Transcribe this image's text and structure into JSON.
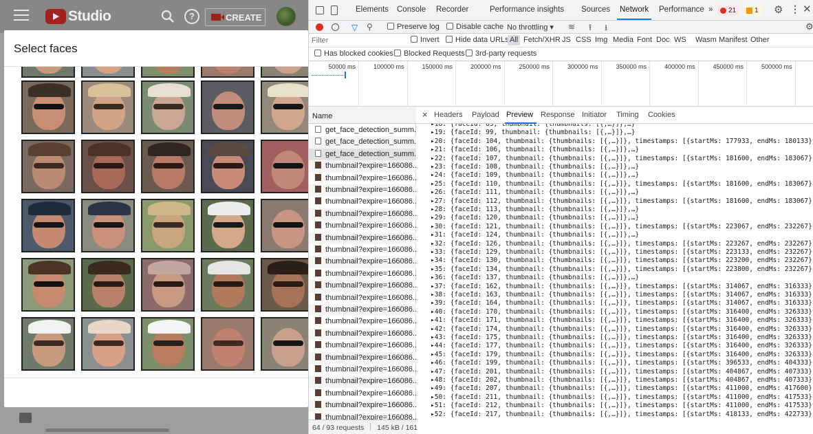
{
  "youtube": {
    "logo_text": "Studio",
    "create_label": "CREATE",
    "help_glyph": "?",
    "modal_title": "Select faces",
    "faces": [
      {
        "skin": "#c79a7e",
        "hat": "#f2f2f2",
        "eyes": "#3a2a22",
        "bg": "#6f7a6a"
      },
      {
        "skin": "#d9a088",
        "hat": "#e8d8c8",
        "eyes": "#3a2a22",
        "bg": "#8a8f90"
      },
      {
        "skin": "#b87c5e",
        "hat": "#f4f4f4",
        "eyes": "#2a2020",
        "bg": "#7b8f6a"
      },
      {
        "skin": "#c08070",
        "hat": "",
        "eyes": "#402a22",
        "bg": "#9a7a6a"
      },
      {
        "skin": "#c9a08c",
        "hat": "",
        "eyes": "#151515",
        "bg": "#8a8275"
      },
      {
        "skin": "#c78e74",
        "hat": "#3a3026",
        "eyes": "#121212",
        "bg": "#7a6a5c"
      },
      {
        "skin": "#d2a486",
        "hat": "#d9c19a",
        "eyes": "#3a2a22",
        "bg": "#9a8a7c"
      },
      {
        "skin": "#c9a794",
        "hat": "#e6dfd2",
        "eyes": "#3a2a22",
        "bg": "#7a8b72"
      },
      {
        "skin": "#c08c7c",
        "hat": "",
        "eyes": "#1a1a1a",
        "bg": "#5a5c62"
      },
      {
        "skin": "#d0a68c",
        "hat": "#e8e0c8",
        "eyes": "#161616",
        "bg": "#92887a"
      },
      {
        "skin": "#bb8a72",
        "hat": "#5a4030",
        "eyes": "#3a2a22",
        "bg": "#7a6a60"
      },
      {
        "skin": "#a86a58",
        "hat": "#4a3226",
        "eyes": "#2a1a14",
        "bg": "#6a5048"
      },
      {
        "skin": "#b87a66",
        "hat": "#302520",
        "eyes": "#2a1a14",
        "bg": "#6a5a50"
      },
      {
        "skin": "#c88a78",
        "hat": "#5a4a40",
        "eyes": "#2a1a14",
        "bg": "#4a4a56"
      },
      {
        "skin": "#c08878",
        "hat": "",
        "eyes": "#141414",
        "bg": "#a06060"
      },
      {
        "skin": "#c58870",
        "hat": "#1f2a3a",
        "eyes": "#151515",
        "bg": "#4a5a6a"
      },
      {
        "skin": "#c89078",
        "hat": "#2a3446",
        "eyes": "#151515",
        "bg": "#8a8a80"
      },
      {
        "skin": "#c8a680",
        "hat": "#cfb78a",
        "eyes": "#3a2a22",
        "bg": "#8a9a6a"
      },
      {
        "skin": "#d4a88a",
        "hat": "#ededed",
        "eyes": "#1a1a1a",
        "bg": "#5a6a4a"
      },
      {
        "skin": "#c89484",
        "hat": "",
        "eyes": "#151515",
        "bg": "#8a7a70"
      },
      {
        "skin": "#c88a6e",
        "hat": "#4a3426",
        "eyes": "#141414",
        "bg": "#8a9a7a"
      },
      {
        "skin": "#b8826a",
        "hat": "#3a2a20",
        "eyes": "#2a1a14",
        "bg": "#5a6a4a"
      },
      {
        "skin": "#c89a82",
        "hat": "#c0a8a0",
        "eyes": "#2a1a14",
        "bg": "#8a6a6a"
      },
      {
        "skin": "#b27a5c",
        "hat": "#e6e6e6",
        "eyes": "#2a1a14",
        "bg": "#6a7a5a"
      },
      {
        "skin": "#a67258",
        "hat": "#2a2018",
        "eyes": "#2a1a14",
        "bg": "#6a5a4a"
      }
    ]
  },
  "devtools": {
    "tabs": [
      "Elements",
      "Console",
      "Recorder",
      "Performance insights",
      "Sources",
      "Network",
      "Performance",
      "»"
    ],
    "active_tab": "Network",
    "errors_count": "21",
    "warnings_count": "1",
    "toolbar": {
      "preserve_log": "Preserve log",
      "disable_cache": "Disable cache",
      "throttling": "No throttling",
      "throttling_arrow": "▾"
    },
    "filter": {
      "placeholder": "Filter",
      "invert": "Invert",
      "hide_data_urls": "Hide data URLs",
      "types": [
        "All",
        "Fetch/XHR",
        "JS",
        "CSS",
        "Img",
        "Media",
        "Font",
        "Doc",
        "WS",
        "Wasm",
        "Manifest",
        "Other"
      ]
    },
    "cookies_bar": {
      "has_blocked": "Has blocked cookies",
      "blocked_requests": "Blocked Requests",
      "third_party": "3rd-party requests"
    },
    "timeline_ticks": [
      "50000 ms",
      "100000 ms",
      "150000 ms",
      "200000 ms",
      "250000 ms",
      "300000 ms",
      "350000 ms",
      "400000 ms",
      "450000 ms",
      "500000 ms"
    ],
    "requests": {
      "header": "Name",
      "items": [
        {
          "name": "get_face_detection_summ...",
          "kind": "doc"
        },
        {
          "name": "get_face_detection_summ...",
          "kind": "doc"
        },
        {
          "name": "get_face_detection_summ...",
          "kind": "doc"
        },
        {
          "name": "thumbnail?expire=166086...",
          "kind": "img"
        },
        {
          "name": "thumbnail?expire=166086...",
          "kind": "img"
        },
        {
          "name": "thumbnail?expire=166086...",
          "kind": "img"
        },
        {
          "name": "thumbnail?expire=166086...",
          "kind": "img"
        },
        {
          "name": "thumbnail?expire=166086...",
          "kind": "img"
        },
        {
          "name": "thumbnail?expire=166086...",
          "kind": "img"
        },
        {
          "name": "thumbnail?expire=166086...",
          "kind": "img"
        },
        {
          "name": "thumbnail?expire=166086...",
          "kind": "img"
        },
        {
          "name": "thumbnail?expire=166086...",
          "kind": "img"
        },
        {
          "name": "thumbnail?expire=166086...",
          "kind": "img"
        },
        {
          "name": "thumbnail?expire=166086...",
          "kind": "img"
        },
        {
          "name": "thumbnail?expire=166086...",
          "kind": "img"
        },
        {
          "name": "thumbnail?expire=166086...",
          "kind": "img"
        },
        {
          "name": "thumbnail?expire=166086...",
          "kind": "img"
        },
        {
          "name": "thumbnail?expire=166086...",
          "kind": "img"
        },
        {
          "name": "thumbnail?expire=166086...",
          "kind": "img"
        },
        {
          "name": "thumbnail?expire=166086...",
          "kind": "img"
        },
        {
          "name": "thumbnail?expire=166086...",
          "kind": "img"
        },
        {
          "name": "thumbnail?expire=166086...",
          "kind": "img"
        },
        {
          "name": "thumbnail?expire=166086...",
          "kind": "img"
        },
        {
          "name": "thumbnail?expire=166086...",
          "kind": "img"
        },
        {
          "name": "thumbnail?expire=166086...",
          "kind": "img"
        }
      ],
      "status": "64 / 93 requests",
      "size": "145 kB / 161"
    },
    "detail_tabs": [
      "Headers",
      "Payload",
      "Preview",
      "Response",
      "Initiator",
      "Timing",
      "Cookies"
    ],
    "detail_close": "×",
    "active_detail_tab": "Preview",
    "preview_rows": [
      "▸18: {faceId: 83, thumbnail: {thumbnails: [{,…}]},…}",
      "▸19: {faceId: 99, thumbnail: {thumbnails: [{,…}]},…}",
      "▸20: {faceId: 104, thumbnail: {thumbnails: [{,…}]}, timestamps: [{startMs: 177933, endMs: 180133}]}",
      "▸21: {faceId: 106, thumbnail: {thumbnails: [{,…}]},…}",
      "▸22: {faceId: 107, thumbnail: {thumbnails: [{,…}]}, timestamps: [{startMs: 181600, endMs: 183067}]}",
      "▸23: {faceId: 108, thumbnail: {thumbnails: [{,…}]},…}",
      "▸24: {faceId: 109, thumbnail: {thumbnails: [{,…}]},…}",
      "▸25: {faceId: 110, thumbnail: {thumbnails: [{,…}]}, timestamps: [{startMs: 181600, endMs: 183067}]}",
      "▸26: {faceId: 111, thumbnail: {thumbnails: [{,…}]},…}",
      "▸27: {faceId: 112, thumbnail: {thumbnails: [{,…}]}, timestamps: [{startMs: 181600, endMs: 183067}]}",
      "▸28: {faceId: 113, thumbnail: {thumbnails: [{,…}]},…}",
      "▸29: {faceId: 120, thumbnail: {thumbnails: [{,…}]},…}",
      "▸30: {faceId: 121, thumbnail: {thumbnails: [{,…}]}, timestamps: [{startMs: 223067, endMs: 232267}]}",
      "▸31: {faceId: 124, thumbnail: {thumbnails: [{,…}]},…}",
      "▸32: {faceId: 126, thumbnail: {thumbnails: [{,…}]}, timestamps: [{startMs: 223267, endMs: 232267}]}",
      "▸33: {faceId: 129, thumbnail: {thumbnails: [{,…}]}, timestamps: [{startMs: 223133, endMs: 232267}]}",
      "▸34: {faceId: 130, thumbnail: {thumbnails: [{,…}]}, timestamps: [{startMs: 223200, endMs: 232267}]}",
      "▸35: {faceId: 134, thumbnail: {thumbnails: [{,…}]}, timestamps: [{startMs: 223800, endMs: 232267}]}",
      "▸36: {faceId: 137, thumbnail: {thumbnails: [{,…}]},…}",
      "▸37: {faceId: 162, thumbnail: {thumbnails: [{,…}]}, timestamps: [{startMs: 314067, endMs: 316333}]}",
      "▸38: {faceId: 163, thumbnail: {thumbnails: [{,…}]}, timestamps: [{startMs: 314067, endMs: 316333}]}",
      "▸39: {faceId: 164, thumbnail: {thumbnails: [{,…}]}, timestamps: [{startMs: 314067, endMs: 316333}]}",
      "▸40: {faceId: 170, thumbnail: {thumbnails: [{,…}]}, timestamps: [{startMs: 316400, endMs: 326333}]}",
      "▸41: {faceId: 171, thumbnail: {thumbnails: [{,…}]}, timestamps: [{startMs: 316400, endMs: 326333}]}",
      "▸42: {faceId: 174, thumbnail: {thumbnails: [{,…}]}, timestamps: [{startMs: 316400, endMs: 326333}]}",
      "▸43: {faceId: 175, thumbnail: {thumbnails: [{,…}]}, timestamps: [{startMs: 316400, endMs: 326333}]}",
      "▸44: {faceId: 177, thumbnail: {thumbnails: [{,…}]}, timestamps: [{startMs: 316400, endMs: 326333}]}",
      "▸45: {faceId: 179, thumbnail: {thumbnails: [{,…}]}, timestamps: [{startMs: 316400, endMs: 326333}]}",
      "▸46: {faceId: 199, thumbnail: {thumbnails: [{,…}]}, timestamps: [{startMs: 396533, endMs: 404333}]}",
      "▸47: {faceId: 201, thumbnail: {thumbnails: [{,…}]}, timestamps: [{startMs: 404867, endMs: 407333}]}",
      "▸48: {faceId: 202, thumbnail: {thumbnails: [{,…}]}, timestamps: [{startMs: 404867, endMs: 407333}]}",
      "▸49: {faceId: 207, thumbnail: {thumbnails: [{,…}]}, timestamps: [{startMs: 411000, endMs: 417600}]}",
      "▸50: {faceId: 211, thumbnail: {thumbnails: [{,…}]}, timestamps: [{startMs: 411000, endMs: 417533}]}",
      "▸51: {faceId: 212, thumbnail: {thumbnails: [{,…}]}, timestamps: [{startMs: 411000, endMs: 417533}]}",
      "▸52: {faceId: 217, thumbnail: {thumbnails: [{,…}]}, timestamps: [{startMs: 418133, endMs: 422733}]}"
    ],
    "colors": {
      "accent": "#1a73e8",
      "error_bg": "#fce8e6",
      "warn_bg": "#fef7e0",
      "record": "#d93025"
    }
  }
}
